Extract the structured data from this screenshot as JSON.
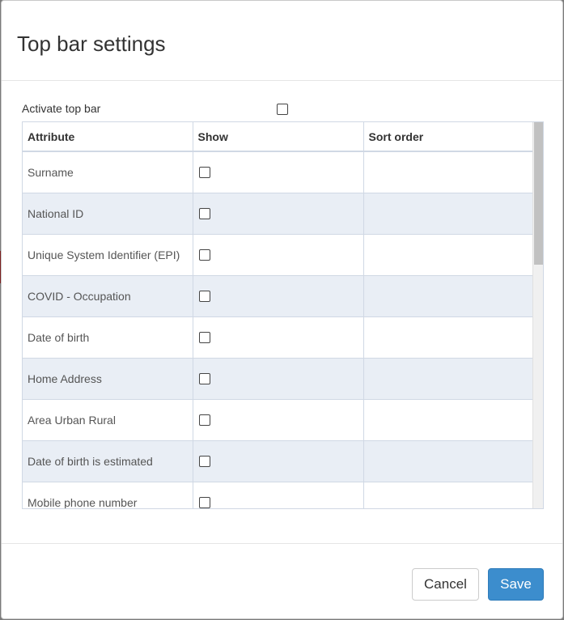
{
  "modal": {
    "title": "Top bar settings",
    "activate_label": "Activate top bar",
    "activate_checked": false
  },
  "table": {
    "headers": [
      "Attribute",
      "Show",
      "Sort order"
    ],
    "rows": [
      {
        "attribute": "Surname",
        "show": false,
        "sort_order": ""
      },
      {
        "attribute": "National ID",
        "show": false,
        "sort_order": ""
      },
      {
        "attribute": "Unique System Identifier (EPI)",
        "show": false,
        "sort_order": ""
      },
      {
        "attribute": "COVID - Occupation",
        "show": false,
        "sort_order": ""
      },
      {
        "attribute": "Date of birth",
        "show": false,
        "sort_order": ""
      },
      {
        "attribute": "Home Address",
        "show": false,
        "sort_order": ""
      },
      {
        "attribute": "Area Urban Rural",
        "show": false,
        "sort_order": ""
      },
      {
        "attribute": "Date of birth is estimated",
        "show": false,
        "sort_order": ""
      },
      {
        "attribute": "Mobile phone number",
        "show": false,
        "sort_order": ""
      }
    ]
  },
  "footer": {
    "cancel_label": "Cancel",
    "save_label": "Save"
  },
  "colors": {
    "primary": "#3c8dcd",
    "alt_row": "#e9eef5"
  }
}
